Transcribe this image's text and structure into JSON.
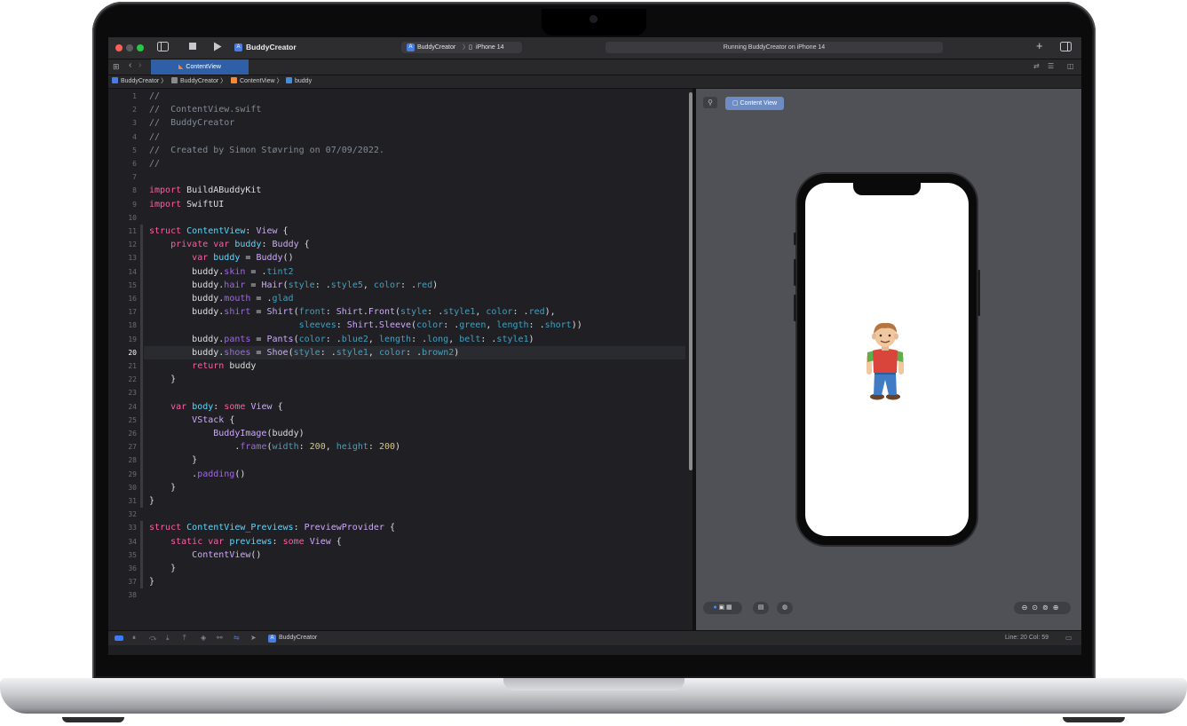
{
  "toolbar": {
    "project_name": "BuddyCreator",
    "scheme": "BuddyCreator",
    "destination": "iPhone 14",
    "status": "Running BuddyCreator on iPhone 14",
    "add_icon": "plus-icon",
    "inspector_icon": "sidebar-right-icon"
  },
  "tabs": [
    {
      "label": "ContentView",
      "icon": "swift-file-icon",
      "active": true
    }
  ],
  "breadcrumb": [
    "BuddyCreator",
    "BuddyCreator",
    "ContentView",
    "buddy"
  ],
  "editor": {
    "current_line": 20,
    "lines": [
      "//",
      "//  ContentView.swift",
      "//  BuddyCreator",
      "//",
      "//  Created by Simon Støvring on 07/09/2022.",
      "//",
      "",
      "import BuildABuddyKit",
      "import SwiftUI",
      "",
      "struct ContentView: View {",
      "    private var buddy: Buddy {",
      "        var buddy = Buddy()",
      "        buddy.skin = .tint2",
      "        buddy.hair = Hair(style: .style5, color: .red)",
      "        buddy.mouth = .glad",
      "        buddy.shirt = Shirt(front: Shirt.Front(style: .style1, color: .red),",
      "                            sleeves: Shirt.Sleeve(color: .green, length: .short))",
      "        buddy.pants = Pants(color: .blue2, length: .long, belt: .style1)",
      "        buddy.shoes = Shoe(style: .style1, color: .brown2)",
      "        return buddy",
      "    }",
      "",
      "    var body: some View {",
      "        VStack {",
      "            BuddyImage(buddy)",
      "                .frame(width: 200, height: 200)",
      "        }",
      "        .padding()",
      "    }",
      "}",
      "",
      "struct ContentView_Previews: PreviewProvider {",
      "    static var previews: some View {",
      "        ContentView()",
      "    }",
      "}",
      ""
    ]
  },
  "canvas": {
    "preview_label": "Content View",
    "pin_icon": "pin-icon",
    "zoom_icons": [
      "zoom-out-icon",
      "zoom-fit-icon",
      "zoom-100-icon",
      "zoom-in-icon"
    ]
  },
  "debugbar": {
    "target": "BuddyCreator",
    "cursor_position": "Line: 20  Col: 59"
  },
  "colors": {
    "keyword": "#fc5fa3",
    "type": "#d0a8ff",
    "comment": "#7f8c98",
    "number": "#d9c97c",
    "accent": "#2f5fa6"
  }
}
